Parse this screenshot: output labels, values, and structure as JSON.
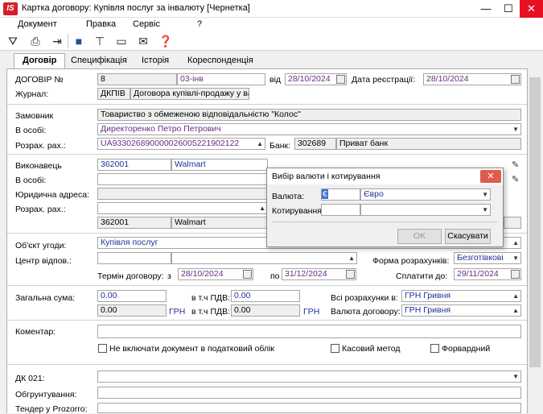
{
  "window": {
    "title": "Картка договору:  Купівля послуг за інвалюту [Чернетка]",
    "min": "—",
    "max": "☐",
    "close": "✕"
  },
  "menu": [
    "Документ",
    "Правка",
    "Сервіс",
    "?"
  ],
  "tabs": [
    "Договір",
    "Специфікація",
    "Історія",
    "Кореспонденція"
  ],
  "contract": {
    "number_label": "ДОГОВІР №",
    "number": "8",
    "code": "03-інв",
    "from_label": "від",
    "date": "28/10/2024",
    "reg_label": "Дата реєстрації:",
    "reg_date": "28/10/2024",
    "journal_label": "Журнал:",
    "journal_code": "ДКПІВ",
    "journal_name": "Договора купівлі-продажу у вал...",
    "customer_label": "Замовник",
    "customer": "Товариство з обмеженою відповідальністю \"Колос\"",
    "person_label": "В особі:",
    "person": "Директоренко Петро Петрович",
    "account_label": "Розрах. рах.:",
    "account": "UA933026890000026005221902122",
    "bank_label": "Банк:",
    "bank_code": "302689",
    "bank_name": "Приват банк",
    "contractor_label": "Виконавець",
    "contractor_code": "362001",
    "contractor_name": "Walmart",
    "contractor_person_label": "В особі:",
    "legal_address_label": "Юридична адреса:",
    "contractor_account_label": "Розрах. рах.:",
    "contractor_code2": "362001",
    "contractor_name2": "Walmart",
    "subject_label": "Об'єкт угоди:",
    "subject": "Купівля послуг",
    "resp_center_label": "Центр відпов.:",
    "pay_form_label": "Форма розрахунків:",
    "pay_form": "Безготівкові",
    "term_label": "Термін договору:",
    "term_from_label": "з",
    "term_from": "28/10/2024",
    "term_to_label": "по",
    "term_to": "31/12/2024",
    "pay_until_label": "Сплатити до:",
    "pay_until": "29/11/2024",
    "total_label": "Загальна сума:",
    "total": "0.00",
    "vat_label": "в т.ч ПДВ:",
    "vat": "0.00",
    "total2": "0.00",
    "currency_short": "ГРН",
    "vat_label2": "в т.ч ПДВ:",
    "vat2": "0.00",
    "currency_short2": "ГРН",
    "all_calc_label": "Всі розрахунки в:",
    "all_calc": "ГРН Гривня",
    "contract_currency_label": "Валюта договору:",
    "contract_currency": "ГРН Гривня",
    "comment_label": "Коментар:",
    "no_tax_label": "Не включати документ в податковий облік",
    "cash_method_label": "Касовий метод",
    "forward_label": "Форвардний",
    "dk_label": "ДК 021:",
    "justification_label": "Обгрунтування:",
    "prozorro_label": "Тендер у Prozorro:"
  },
  "dialog": {
    "title": "Вибір валюти і котирування",
    "currency_label": "Валюта:",
    "currency_code": "€",
    "currency_name": "Євро",
    "quote_label": "Котирування",
    "ok": "OK",
    "cancel": "Скасувати"
  }
}
